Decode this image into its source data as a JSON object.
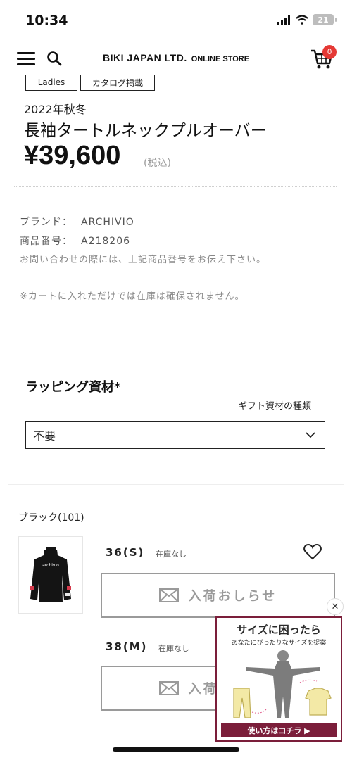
{
  "status_bar": {
    "time": "10:34",
    "battery": "21"
  },
  "header": {
    "store_name": "BIKI JAPAN LTD.",
    "store_suffix": "ONLINE STORE",
    "cart_count": "0"
  },
  "tags": [
    "Ladies",
    "カタログ掲載"
  ],
  "product": {
    "season": "2022年秋冬",
    "name": "長袖タートルネックプルオーバー",
    "price": "¥39,600",
    "tax_note": "(税込)"
  },
  "details": {
    "brand_label": "ブランド：",
    "brand_value": "ARCHIVIO",
    "sku_label": "商品番号：",
    "sku_value": "A218206",
    "inquiry_note": "お問い合わせの際には、上記商品番号をお伝え下さい。",
    "cart_note": "※カートに入れただけでは在庫は確保されません。"
  },
  "wrapping": {
    "title": "ラッピング資材",
    "required_mark": "*",
    "gift_link": "ギフト資材の種類",
    "selected": "不要"
  },
  "variant": {
    "color_name": "ブラック(101)",
    "sizes": [
      {
        "label": "36(S)",
        "stock": "在庫なし",
        "button": "入荷おしらせ"
      },
      {
        "label": "38(M)",
        "stock": "在庫なし",
        "button": "入荷おしらせ"
      }
    ]
  },
  "banner": {
    "title": "サイズに困ったら",
    "subtitle": "あなたにぴったりなサイズを提案",
    "cta": "使い方はコチラ ▶"
  },
  "colors": {
    "accent": "#7b1e3a",
    "badge": "#e53935"
  }
}
